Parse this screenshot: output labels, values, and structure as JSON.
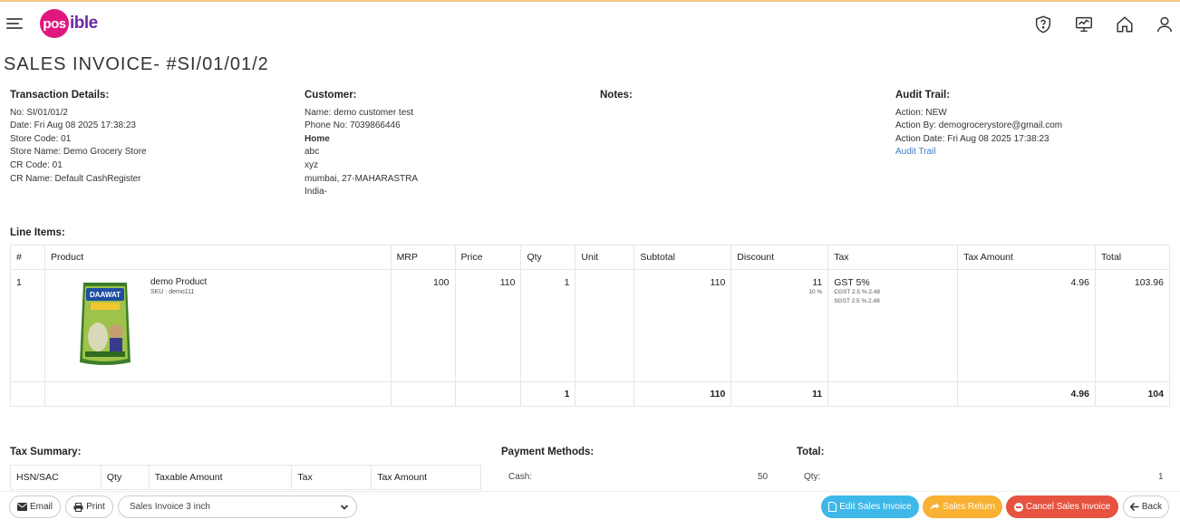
{
  "header": {
    "logo_circle": "pos",
    "logo_rest": "ible"
  },
  "page": {
    "title": "SALES INVOICE- #SI/01/01/2"
  },
  "transaction": {
    "heading": "Transaction Details:",
    "no": "No: SI/01/01/2",
    "date": "Date: Fri Aug 08 2025 17:38:23",
    "store_code": "Store Code: 01",
    "store_name": "Store Name: Demo Grocery Store",
    "cr_code": "CR Code: 01",
    "cr_name": "CR Name: Default CashRegister"
  },
  "customer": {
    "heading": "Customer:",
    "name": "Name: demo customer test",
    "phone": "Phone No: 7039866446",
    "address_type": "Home",
    "line1": "abc",
    "line2": "xyz",
    "city": "mumbai, 27-MAHARASTRA",
    "country": "India-"
  },
  "notes": {
    "heading": "Notes:"
  },
  "audit": {
    "heading": "Audit Trail:",
    "action": "Action: NEW",
    "action_by": "Action By: demogrocerystore@gmail.com",
    "action_date": "Action Date: Fri Aug 08 2025 17:38:23",
    "link": "Audit Trail"
  },
  "line_items": {
    "label": "Line Items:",
    "columns": [
      "#",
      "Product",
      "MRP",
      "Price",
      "Qty",
      "Unit",
      "Subtotal",
      "Discount",
      "Tax",
      "Tax Amount",
      "Total"
    ],
    "row": {
      "index": "1",
      "product_name": "demo Product",
      "sku": "SKU : demo111",
      "mrp": "100",
      "price": "110",
      "qty": "1",
      "unit": "",
      "subtotal": "110",
      "discount": "11",
      "discount_pct": "10 %",
      "tax": "GST 5%",
      "tax_cgst": "CGST 2.5 %:2.48",
      "tax_sgst": "SGST 2.5 %:2.48",
      "tax_amount": "4.96",
      "total": "103.96"
    },
    "totals": {
      "qty": "1",
      "subtotal": "110",
      "discount": "11",
      "tax_amount": "4.96",
      "total": "104"
    }
  },
  "tax_summary": {
    "label": "Tax Summary:",
    "columns": [
      "HSN/SAC",
      "Qty",
      "Taxable Amount",
      "Tax",
      "Tax Amount"
    ]
  },
  "payment_methods": {
    "label": "Payment Methods:",
    "cash_label": "Cash:",
    "cash_value": "50"
  },
  "total_section": {
    "label": "Total:",
    "qty_label": "Qty:",
    "qty_value": "1"
  },
  "footer": {
    "email": "Email",
    "print": "Print",
    "print_format": "Sales Invoice 3 inch",
    "edit": "Edit Sales Invoice",
    "return": "Sales Return",
    "cancel": "Cancel Sales Invoice",
    "back": "Back"
  },
  "colors": {
    "brand_pink": "#e0187e",
    "brand_purple": "#6a2aa6",
    "link_blue": "#3a7dc9",
    "edit_blue": "#3db8e8",
    "return_yellow": "#f8b133",
    "cancel_red": "#e65340"
  }
}
